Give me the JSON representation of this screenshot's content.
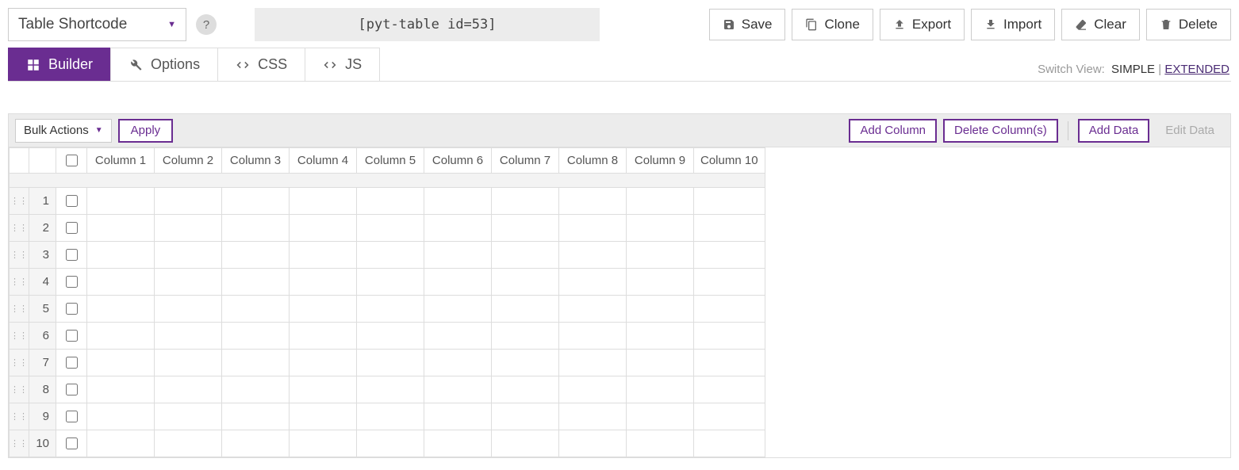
{
  "dropdown": {
    "label": "Table Shortcode"
  },
  "shortcode": "[pyt-table id=53]",
  "toolbar": {
    "save": "Save",
    "clone": "Clone",
    "export": "Export",
    "import": "Import",
    "clear": "Clear",
    "delete": "Delete"
  },
  "tabs": {
    "builder": "Builder",
    "options": "Options",
    "css": "CSS",
    "js": "JS"
  },
  "switchview": {
    "label": "Switch View:",
    "simple": "SIMPLE",
    "sep": " | ",
    "extended": "EXTENDED"
  },
  "bulk": {
    "label": "Bulk Actions",
    "apply": "Apply"
  },
  "panelbtns": {
    "addcol": "Add Column",
    "delcol": "Delete Column(s)",
    "adddata": "Add Data",
    "editdata": "Edit Data"
  },
  "columns": [
    "Column 1",
    "Column 2",
    "Column 3",
    "Column 4",
    "Column 5",
    "Column 6",
    "Column 7",
    "Column 8",
    "Column 9",
    "Column 10"
  ],
  "rows": [
    "1",
    "2",
    "3",
    "4",
    "5",
    "6",
    "7",
    "8",
    "9",
    "10"
  ]
}
